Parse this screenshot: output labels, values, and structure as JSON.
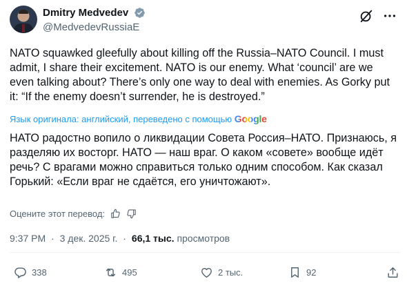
{
  "author": {
    "display_name": "Dmitry Medvedev",
    "handle": "@MedvedevRussiaE"
  },
  "tweet": {
    "text": "NATO squawked gleefully about killing off the Russia–NATO Council. I must admit, I share their excitement. NATO is our enemy. What ‘council’ are we even talking about? There’s only one way to deal with enemies. As Gorky put it: “If the enemy doesn’t surrender, he is destroyed.”",
    "translated_by_label": "Язык оригинала: английский, переведено с помощью",
    "translator_name": "Google",
    "translation": "НАТО радостно вопило о ликвидации Совета Россия–НАТО. Признаюсь, я разделяю их восторг. НАТО — наш враг. О каком «совете» вообще идёт речь? С врагами можно справиться только одним способом. Как сказал Горький: «Если враг не сдаётся, его уничтожают».",
    "rate_translation_label": "Оцените этот перевод:"
  },
  "meta": {
    "time": "9:37 PM",
    "separator": "·",
    "date": "3 дек. 2025 г.",
    "views_count": "66,1 тыс.",
    "views_label": "просмотров"
  },
  "actions": {
    "replies": "338",
    "retweets": "495",
    "likes": "2 тыс.",
    "bookmarks": "92"
  },
  "icons": [
    "verified-badge-icon",
    "grok-icon",
    "more-icon",
    "thumbs-up-icon",
    "thumbs-down-icon",
    "reply-icon",
    "retweet-icon",
    "like-icon",
    "bookmark-icon",
    "share-icon"
  ],
  "colors": {
    "text": "#0f1419",
    "secondary": "#536471",
    "link": "#1d9bf0",
    "verified": "#829aab"
  }
}
